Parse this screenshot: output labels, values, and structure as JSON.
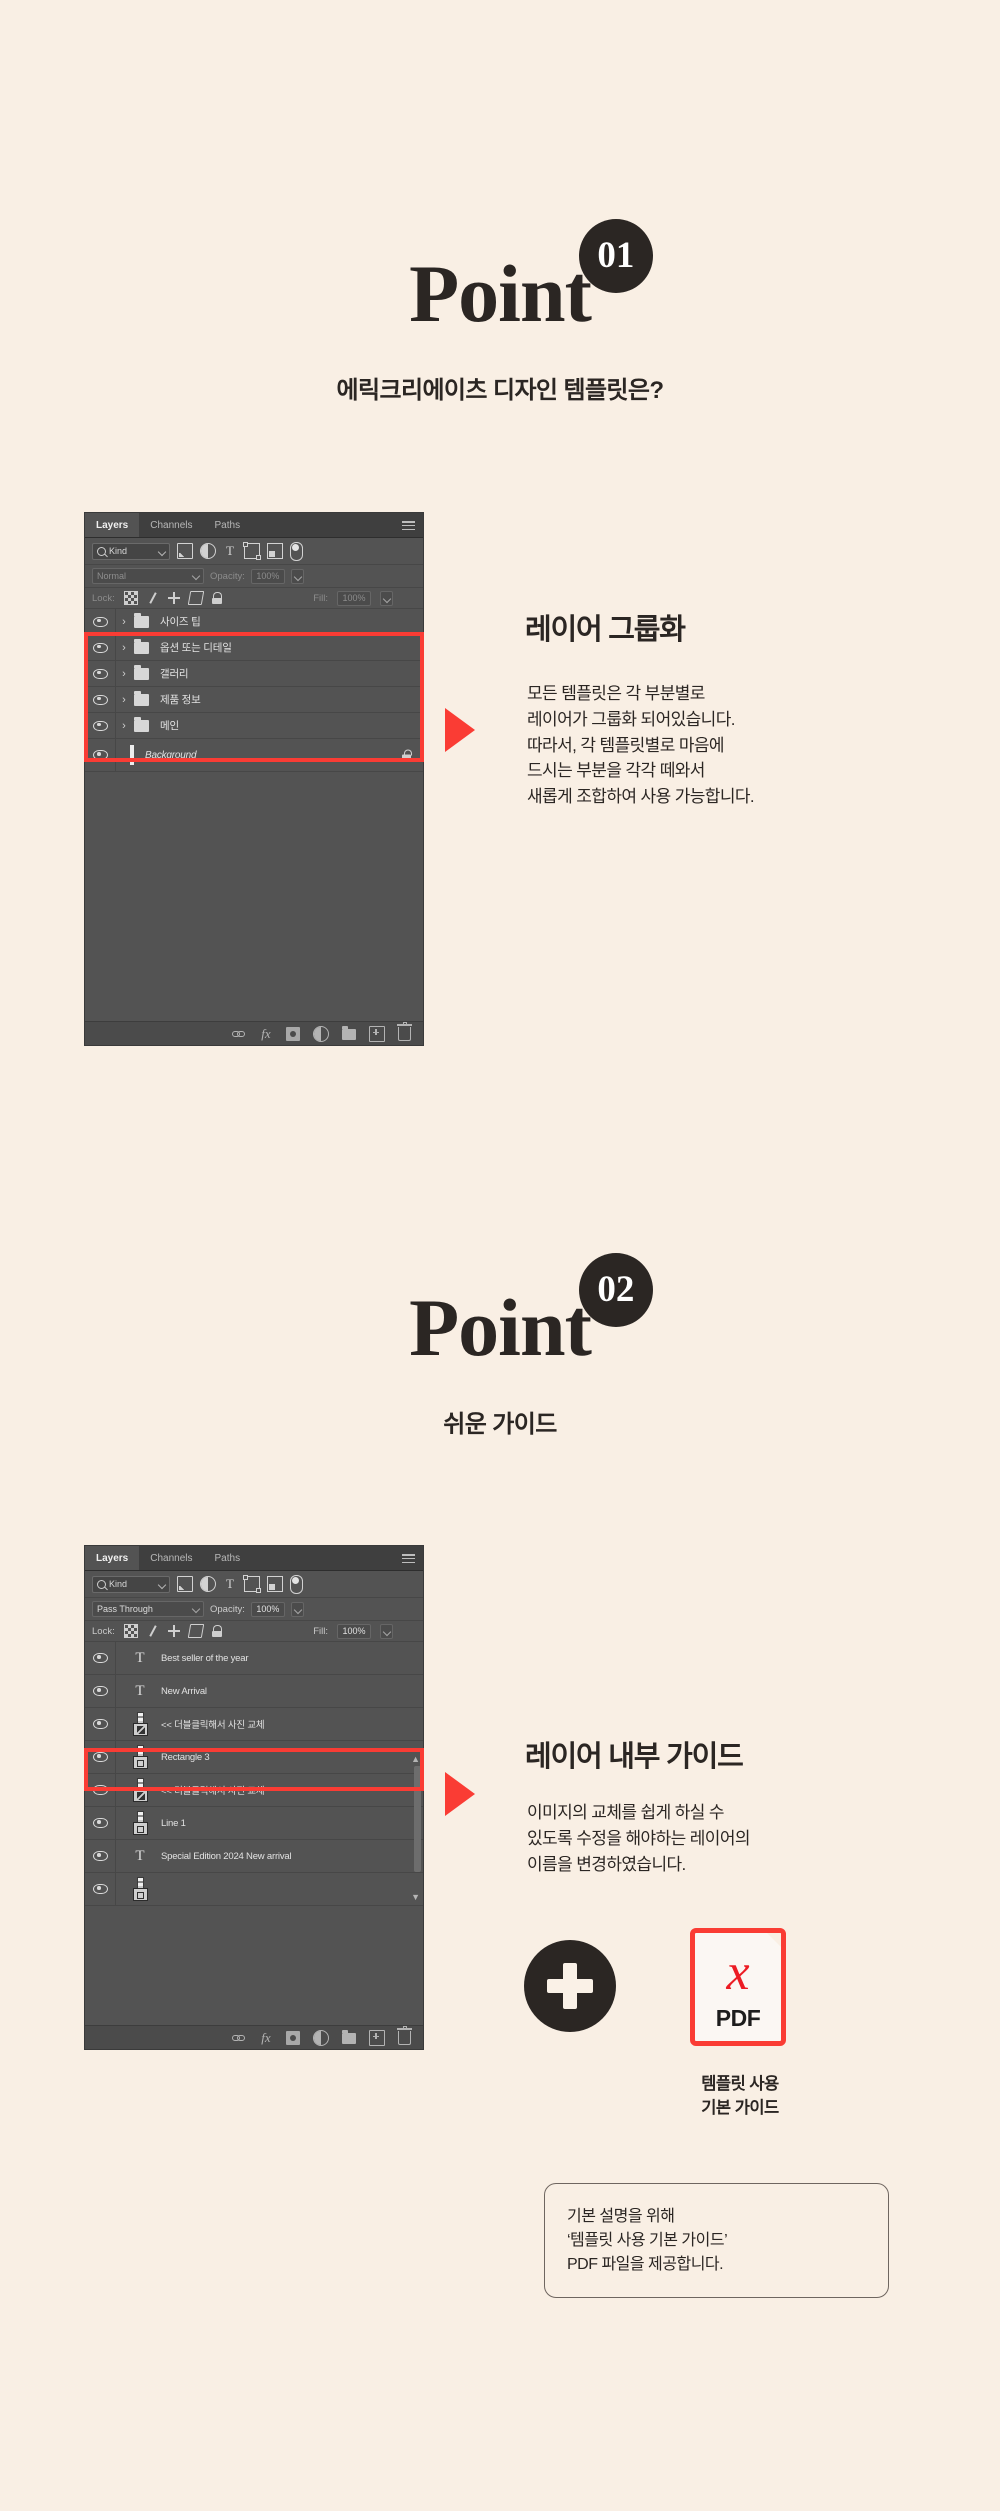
{
  "page": {
    "background_color": "#f9efe4",
    "accent_red": "#fa3c34",
    "dark": "#2b2623"
  },
  "point1": {
    "word": "Point",
    "badge": "01",
    "subtitle": "에릭크리에이츠 디자인 템플릿은?",
    "section_title": "레이어 그룹화",
    "body_lines": [
      "모든 템플릿은 각 부분별로",
      "레이어가 그룹화 되어있습니다.",
      "따라서, 각 템플릿별로 마음에",
      "드시는 부분을 각각 떼와서",
      "새롭게 조합하여 사용 가능합니다."
    ]
  },
  "point2": {
    "word": "Point",
    "badge": "02",
    "subtitle": "쉬운 가이드",
    "section_title": "레이어 내부 가이드",
    "body_lines": [
      "이미지의 교체를 쉽게 하실 수",
      "있도록 수정을 해야하는 레이어의",
      "이름을 변경하였습니다."
    ],
    "pdf_label": "PDF",
    "pdf_caption_lines": [
      "템플릿 사용",
      "기본 가이드"
    ],
    "note_lines": [
      "기본 설명을 위해",
      "‘템플릿 사용 기본 가이드’",
      "PDF 파일을 제공합니다."
    ]
  },
  "panel1": {
    "tabs": [
      {
        "label": "Layers",
        "active": true
      },
      {
        "label": "Channels",
        "active": false
      },
      {
        "label": "Paths",
        "active": false
      }
    ],
    "filter_kind": "Kind",
    "filter_icons": [
      "image-filter-icon",
      "adjustment-filter-icon",
      "type-filter-icon",
      "shape-filter-icon",
      "smart-object-filter-icon",
      "filter-toggle-icon"
    ],
    "blend_mode": "Normal",
    "opacity_label": "Opacity:",
    "opacity_value": "100%",
    "lock_label": "Lock:",
    "fill_label": "Fill:",
    "fill_value": "100%",
    "layers": [
      {
        "name": "사이즈 팁",
        "type": "group"
      },
      {
        "name": "옵션 또는 디테일",
        "type": "group"
      },
      {
        "name": "갤러리",
        "type": "group"
      },
      {
        "name": "제품 정보",
        "type": "group"
      },
      {
        "name": "메인",
        "type": "group"
      }
    ],
    "background_layer": "Background"
  },
  "panel2": {
    "tabs": [
      {
        "label": "Layers",
        "active": true
      },
      {
        "label": "Channels",
        "active": false
      },
      {
        "label": "Paths",
        "active": false
      }
    ],
    "filter_kind": "Kind",
    "blend_mode": "Pass Through",
    "opacity_label": "Opacity:",
    "opacity_value": "100%",
    "lock_label": "Lock:",
    "fill_label": "Fill:",
    "fill_value": "100%",
    "layers": [
      {
        "name": "Best seller of the year",
        "type": "text"
      },
      {
        "name": "New Arrival",
        "type": "text"
      },
      {
        "name": "<< 더블클릭해서 사진 교체",
        "type": "smart",
        "highlighted": true
      },
      {
        "name": "Rectangle 3",
        "type": "shape"
      },
      {
        "name": "<< 더블클릭해서 사진 교체",
        "type": "smart"
      },
      {
        "name": "Line 1",
        "type": "shape"
      },
      {
        "name": "Special Edition 2024 New arrival",
        "type": "text"
      }
    ]
  }
}
